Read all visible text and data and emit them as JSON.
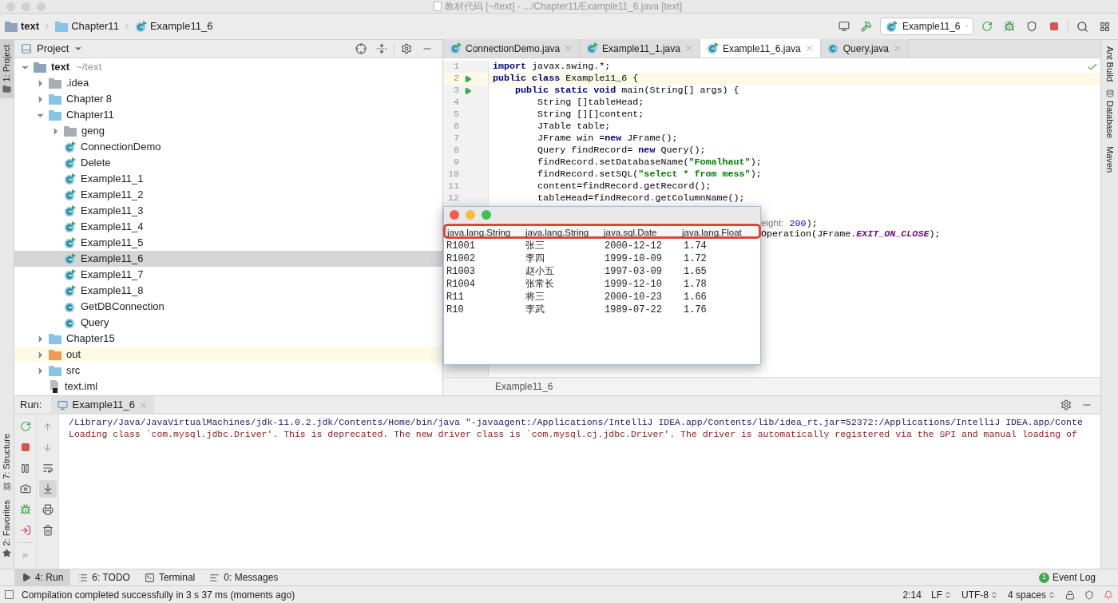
{
  "window": {
    "title": "教材代码 [~/text] - .../Chapter11/Example11_6.java [text]"
  },
  "navbar": {
    "breadcrumbs": [
      {
        "label": "text",
        "kind": "module"
      },
      {
        "label": "Chapter11",
        "kind": "folder"
      },
      {
        "label": "Example11_6",
        "kind": "class"
      }
    ],
    "run_configuration": "Example11_6"
  },
  "left_strip": {
    "top": [
      {
        "label": "1: Project",
        "selected": true
      }
    ],
    "bottom": [
      {
        "label": "7: Structure",
        "selected": false
      },
      {
        "label": "2: Favorites",
        "selected": false
      }
    ]
  },
  "right_strip": [
    "Ant Build",
    "Database",
    "Maven"
  ],
  "project_panel": {
    "title": "Project",
    "tree": [
      {
        "label": "text",
        "note": "~/text",
        "kind": "module",
        "expanded": true,
        "selected": false,
        "children": [
          {
            "label": ".idea",
            "kind": "plainfolder",
            "expanded": false,
            "selected": false
          },
          {
            "label": "Chapter 8",
            "kind": "sourcefolder",
            "expanded": false,
            "selected": false
          },
          {
            "label": "Chapter11",
            "kind": "sourcefolder",
            "expanded": true,
            "selected": false,
            "children": [
              {
                "label": "geng",
                "kind": "package",
                "expanded": false,
                "selected": false
              },
              {
                "label": "ConnectionDemo",
                "kind": "mainclass",
                "selected": false
              },
              {
                "label": "Delete",
                "kind": "mainclass",
                "selected": false
              },
              {
                "label": "Example11_1",
                "kind": "mainclass",
                "selected": false
              },
              {
                "label": "Example11_2",
                "kind": "mainclass",
                "selected": false
              },
              {
                "label": "Example11_3",
                "kind": "mainclass",
                "selected": false
              },
              {
                "label": "Example11_4",
                "kind": "mainclass",
                "selected": false
              },
              {
                "label": "Example11_5",
                "kind": "mainclass",
                "selected": false
              },
              {
                "label": "Example11_6",
                "kind": "mainclass",
                "selected": true
              },
              {
                "label": "Example11_7",
                "kind": "mainclass",
                "selected": false
              },
              {
                "label": "Example11_8",
                "kind": "mainclass",
                "selected": false
              },
              {
                "label": "GetDBConnection",
                "kind": "class",
                "selected": false
              },
              {
                "label": "Query",
                "kind": "class",
                "selected": false
              }
            ]
          },
          {
            "label": "Chapter15",
            "kind": "sourcefolder",
            "expanded": false,
            "selected": false
          },
          {
            "label": "out",
            "kind": "excluded",
            "expanded": false,
            "selected": false
          },
          {
            "label": "src",
            "kind": "sourcefolder",
            "expanded": false,
            "selected": false
          },
          {
            "label": "text.iml",
            "kind": "file",
            "selected": false
          }
        ]
      }
    ]
  },
  "editor": {
    "tabs": [
      {
        "label": "ConnectionDemo.java",
        "kind": "mainclass",
        "selected": false
      },
      {
        "label": "Example11_1.java",
        "kind": "mainclass",
        "selected": false
      },
      {
        "label": "Example11_6.java",
        "kind": "mainclass",
        "selected": true
      },
      {
        "label": "Query.java",
        "kind": "class",
        "selected": false
      }
    ],
    "lines": [
      {
        "number": "1",
        "current": false,
        "runnable": false,
        "segments": [
          {
            "kind": "keyword",
            "text": "import"
          },
          {
            "kind": "plain",
            "text": " javax.swing.*;"
          }
        ]
      },
      {
        "number": "2",
        "current": true,
        "runnable": true,
        "segments": [
          {
            "kind": "keyword",
            "text": "public class"
          },
          {
            "kind": "plain",
            "text": " Example11_6 {"
          }
        ]
      },
      {
        "number": "3",
        "current": false,
        "runnable": true,
        "segments": [
          {
            "kind": "keyword",
            "text": "    public static void"
          },
          {
            "kind": "plain",
            "text": " main(String[] args) {"
          }
        ]
      },
      {
        "number": "4",
        "current": false,
        "runnable": false,
        "segments": [
          {
            "kind": "plain",
            "text": "        String []tableHead;"
          }
        ]
      },
      {
        "number": "5",
        "current": false,
        "runnable": false,
        "segments": [
          {
            "kind": "plain",
            "text": "        String [][]content;"
          }
        ]
      },
      {
        "number": "6",
        "current": false,
        "runnable": false,
        "segments": [
          {
            "kind": "plain",
            "text": "        JTable table;"
          }
        ]
      },
      {
        "number": "7",
        "current": false,
        "runnable": false,
        "segments": [
          {
            "kind": "plain",
            "text": "        JFrame win ="
          },
          {
            "kind": "keyword",
            "text": "new"
          },
          {
            "kind": "plain",
            "text": " JFrame();"
          }
        ]
      },
      {
        "number": "8",
        "current": false,
        "runnable": false,
        "segments": [
          {
            "kind": "plain",
            "text": "        Query findRecord= "
          },
          {
            "kind": "keyword",
            "text": "new"
          },
          {
            "kind": "plain",
            "text": " Query();"
          }
        ]
      },
      {
        "number": "9",
        "current": false,
        "runnable": false,
        "segments": [
          {
            "kind": "plain",
            "text": "        findRecord.setDatabaseName("
          },
          {
            "kind": "string",
            "text": "\"Fomalhaut\""
          },
          {
            "kind": "plain",
            "text": ");"
          }
        ]
      },
      {
        "number": "10",
        "current": false,
        "runnable": false,
        "segments": [
          {
            "kind": "plain",
            "text": "        findRecord.setSQL("
          },
          {
            "kind": "string",
            "text": "\"select * from mess\""
          },
          {
            "kind": "plain",
            "text": ");"
          }
        ]
      },
      {
        "number": "11",
        "current": false,
        "runnable": false,
        "segments": [
          {
            "kind": "plain",
            "text": "        content=findRecord.getRecord();"
          }
        ]
      },
      {
        "number": "12",
        "current": false,
        "runnable": false,
        "segments": [
          {
            "kind": "plain",
            "text": "        tableHead=findRecord.getColumnName();"
          }
        ]
      }
    ],
    "covered_lines": [
      {
        "segments": [
          {
            "kind": "hint",
            "text": "eight:"
          },
          {
            "kind": "number",
            "text": "200"
          },
          {
            "kind": "plain",
            "text": ");"
          }
        ]
      },
      {
        "segments": [
          {
            "kind": "plain",
            "text": "Operation(JFrame."
          },
          {
            "kind": "constant",
            "text": "EXIT_ON_CLOSE"
          },
          {
            "kind": "plain",
            "text": ");"
          }
        ]
      }
    ],
    "breadcrumb": "Example11_6"
  },
  "dialog": {
    "columns": [
      "java.lang.String",
      "java.lang.String",
      "java.sql.Date",
      "java.lang.Float"
    ],
    "rows": [
      [
        "R1001",
        "张三",
        "2000-12-12",
        "1.74"
      ],
      [
        "R1002",
        "李四",
        "1999-10-09",
        "1.72"
      ],
      [
        "R1003",
        "赵小五",
        "1997-03-09",
        "1.65"
      ],
      [
        "R1004",
        "张常长",
        "1999-12-10",
        "1.78"
      ],
      [
        "R11",
        "将三",
        "2000-10-23",
        "1.66"
      ],
      [
        "R10",
        "李武",
        "1989-07-22",
        "1.76"
      ]
    ]
  },
  "run_panel": {
    "label": "Run:",
    "tab": "Example11_6",
    "console": [
      {
        "kind": "command",
        "text": "/Library/Java/JavaVirtualMachines/jdk-11.0.2.jdk/Contents/Home/bin/java \"-javaagent:/Applications/IntelliJ IDEA.app/Contents/lib/idea_rt.jar=52372:/Applications/IntelliJ IDEA.app/Conte"
      },
      {
        "kind": "error",
        "text": "Loading class `com.mysql.jdbc.Driver'. This is deprecated. The new driver class is `com.mysql.cj.jdbc.Driver'. The driver is automatically registered via the SPI and manual loading of"
      }
    ]
  },
  "tool_tabs": [
    {
      "label": "4: Run",
      "kind": "run",
      "selected": true
    },
    {
      "label": "6: TODO",
      "kind": "todo",
      "selected": false
    },
    {
      "label": "Terminal",
      "kind": "terminal",
      "selected": false
    },
    {
      "label": "0: Messages",
      "kind": "messages",
      "selected": false
    }
  ],
  "event_log": {
    "label": "Event Log",
    "count": "1"
  },
  "status_bar": {
    "message": "Compilation completed successfully in 3 s 37 ms (moments ago)",
    "position": "2:14",
    "line_separator": "LF",
    "encoding": "UTF-8",
    "indent": "4 spaces"
  }
}
